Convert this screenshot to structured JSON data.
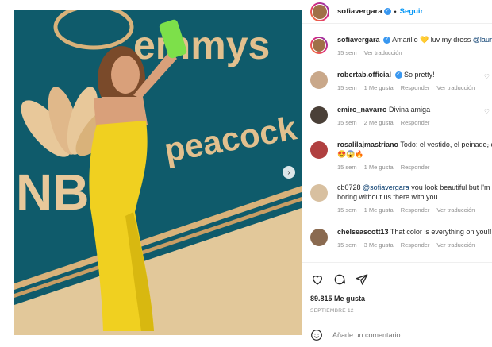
{
  "post": {
    "author": "sofiavergara",
    "follow_label": "Seguir",
    "separator": "•",
    "likes": "89.815 Me gusta",
    "date": "SEPTIEMBRE 12",
    "comment_placeholder": "Añade un comentario..."
  },
  "caption": {
    "username": "sofiavergara",
    "text": "Amarillo 💛 luv my dress ",
    "mention": "@laura",
    "time": "15 sem",
    "translate": "Ver traducción"
  },
  "photo": {
    "sign_emmys": "emmys",
    "sign_peacock": "peacock",
    "sign_nbc": "NB",
    "colors": {
      "wall": "#0f5b6b",
      "gold": "#d9b27a",
      "dress": "#f0d020",
      "floor": "#e2c89a"
    }
  },
  "comments": [
    {
      "username": "robertab.official",
      "verified": true,
      "text": "So pretty!",
      "time": "15 sem",
      "likes": "1 Me gusta",
      "reply": "Responder",
      "translate": "Ver traducción"
    },
    {
      "username": "emiro_navarro",
      "verified": false,
      "text": "Divina amiga",
      "time": "15 sem",
      "likes": "2 Me gusta",
      "reply": "Responder",
      "translate": ""
    },
    {
      "username": "rosalilajmastriano",
      "verified": false,
      "text": "Todo: el vestido, el peinado, e",
      "text2": "😍😱🔥",
      "time": "15 sem",
      "likes": "1 Me gusta",
      "reply": "Responder",
      "translate": ""
    },
    {
      "username": "cb0728",
      "verified": false,
      "mention": "@sofiavergara",
      "text": " you look beautiful but I'm",
      "text2": "boring without us there with you",
      "time": "15 sem",
      "likes": "1 Me gusta",
      "reply": "Responder",
      "translate": "Ver traducción"
    },
    {
      "username": "chelseascott13",
      "verified": false,
      "text": "That color is everything on you!!",
      "time": "15 sem",
      "likes": "3 Me gusta",
      "reply": "Responder",
      "translate": "Ver traducción"
    }
  ],
  "icons": {
    "heart": "heart-icon",
    "comment": "comment-icon",
    "share": "share-icon",
    "emoji": "emoji-icon",
    "next": "chevron-right-icon",
    "verified": "verified-icon"
  },
  "glyphs": {
    "next": "›",
    "verified": "✓",
    "like": "♡"
  }
}
